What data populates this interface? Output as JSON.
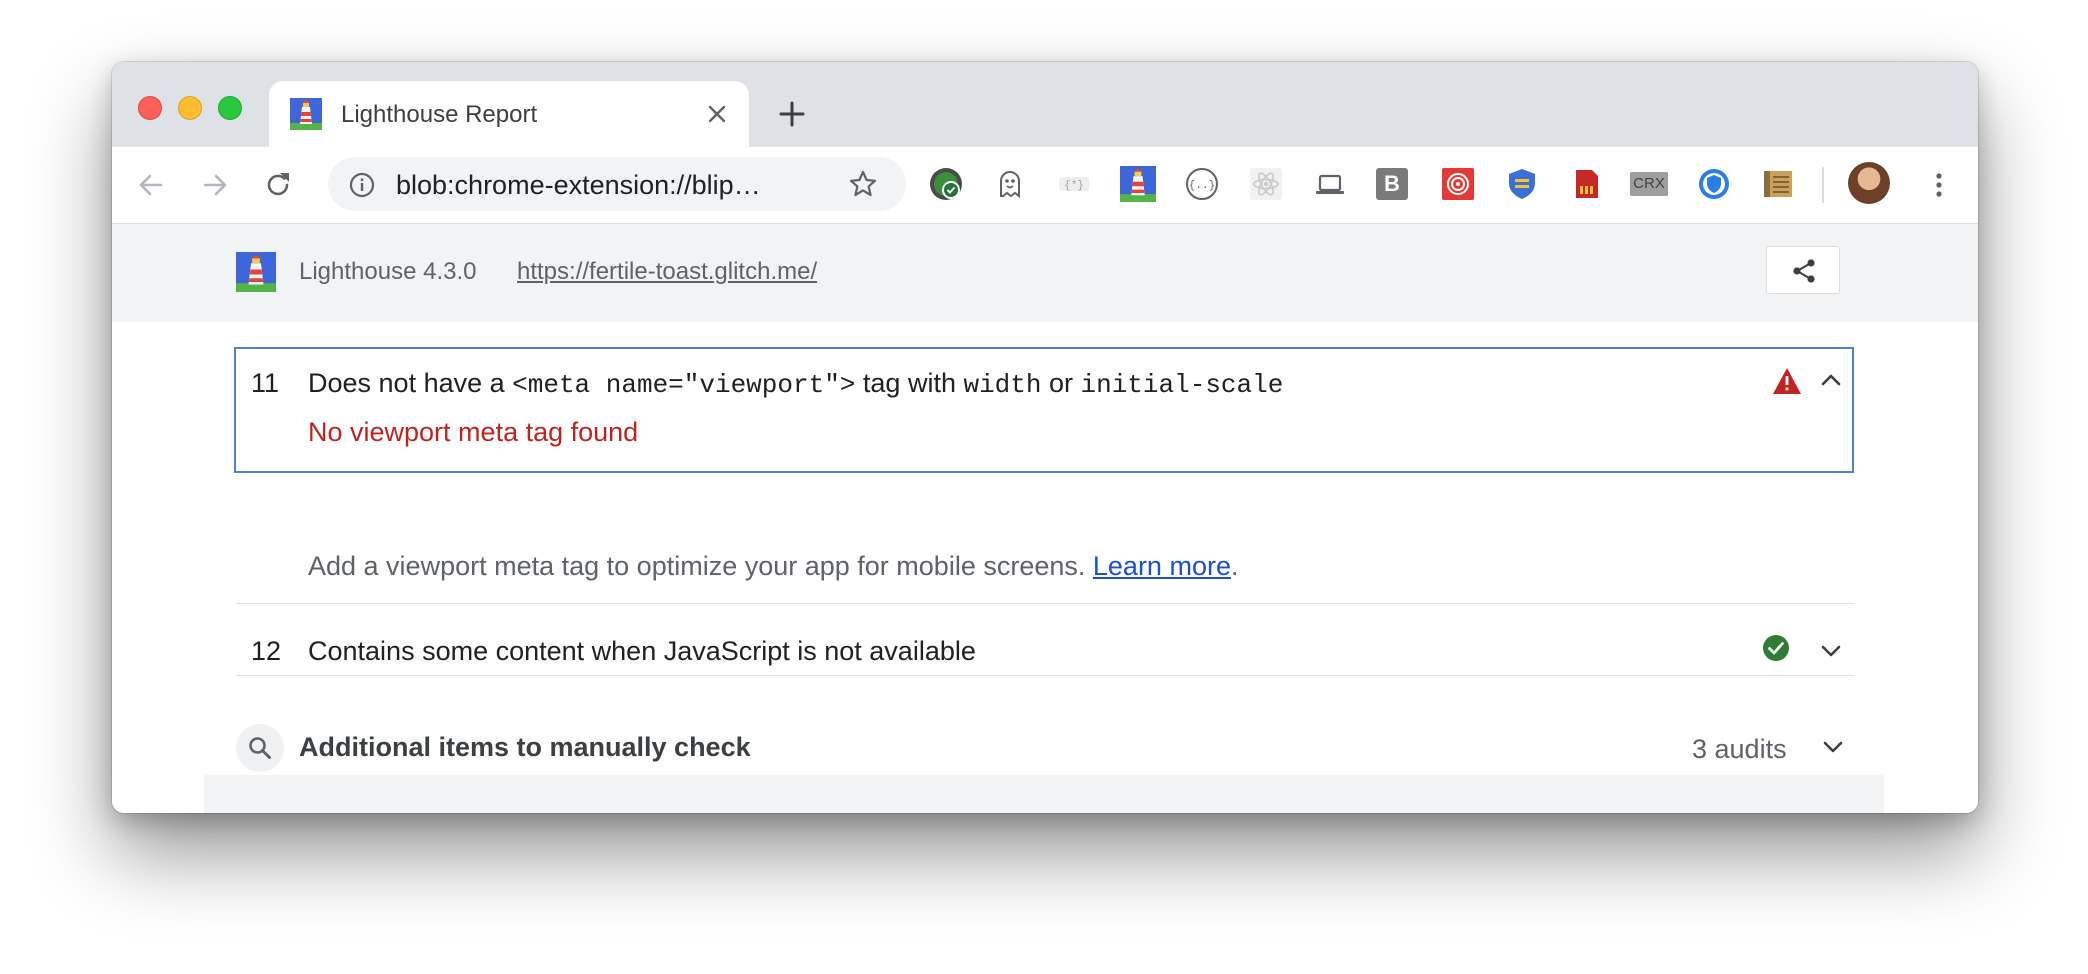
{
  "tab": {
    "title": "Lighthouse Report",
    "favicon": "lighthouse-icon"
  },
  "toolbar": {
    "url": "blob:chrome-extension://blip…",
    "extensions": [
      "green-check-extension-icon",
      "ghost-extension-icon",
      "asterisk-extension-icon",
      "lighthouse-extension-icon",
      "json-braces-extension-icon",
      "react-extension-icon",
      "laptop-extension-icon",
      "b-extension-icon",
      "red-spiral-extension-icon",
      "shield-extension-icon",
      "sd-card-extension-icon",
      "crx-extension-icon",
      "blue-shield-extension-icon",
      "notebook-extension-icon"
    ],
    "crx_label": "CRX",
    "b_label": "B"
  },
  "report": {
    "version": "Lighthouse 4.3.0",
    "url": "https://fertile-toast.glitch.me/"
  },
  "audits": [
    {
      "number": "11",
      "title_parts": [
        "Does not have a ",
        "<meta name=\"viewport\">",
        " tag with ",
        "width",
        " or ",
        "initial-scale"
      ],
      "fail_text": "No viewport meta tag found",
      "description": "Add a viewport meta tag to optimize your app for mobile screens. ",
      "learn_more": "Learn more",
      "period": ".",
      "status": "warning",
      "expanded": true
    },
    {
      "number": "12",
      "title": "Contains some content when JavaScript is not available",
      "status": "pass",
      "expanded": false
    }
  ],
  "manual": {
    "title": "Additional items to manually check",
    "count": "3 audits"
  },
  "colors": {
    "fail": "#c5221f",
    "pass": "#2e7d32",
    "warning": "#c5221f",
    "focus": "#4a83d9",
    "link": "#1a4fd6"
  }
}
